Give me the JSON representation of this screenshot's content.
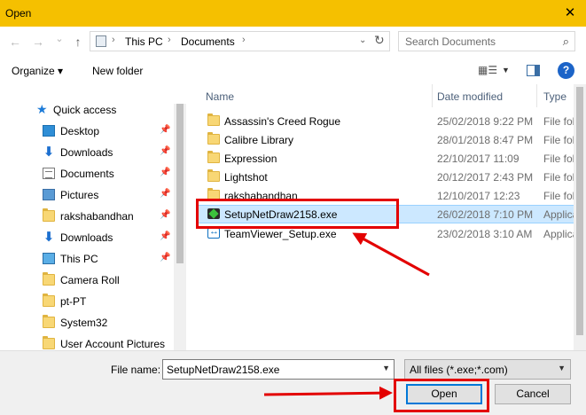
{
  "window": {
    "title": "Open",
    "close_glyph": "✕"
  },
  "address": {
    "crumbs": [
      "This PC",
      "Documents"
    ],
    "separator": "›",
    "dropdown_glyph": "⌄",
    "refresh_glyph": "↻"
  },
  "nav": {
    "back_glyph": "←",
    "forward_glyph": "→",
    "recent_glyph": "⌄",
    "up_glyph": "↑"
  },
  "search": {
    "placeholder": "Search Documents",
    "icon": "search-icon"
  },
  "toolbar": {
    "organize_label": "Organize ▾",
    "new_folder_label": "New folder",
    "help_glyph": "?"
  },
  "sidebar": {
    "items": [
      {
        "label": "Quick access",
        "icon": "star-icon",
        "pinned": false
      },
      {
        "label": "Desktop",
        "icon": "desktop-icon",
        "pinned": true
      },
      {
        "label": "Downloads",
        "icon": "download-icon",
        "pinned": true
      },
      {
        "label": "Documents",
        "icon": "documents-icon",
        "pinned": true
      },
      {
        "label": "Pictures",
        "icon": "pictures-icon",
        "pinned": true
      },
      {
        "label": "rakshabandhan",
        "icon": "folder-icon",
        "pinned": true
      },
      {
        "label": "Downloads",
        "icon": "download-icon",
        "pinned": true
      },
      {
        "label": "This PC",
        "icon": "pc-icon",
        "pinned": true
      },
      {
        "label": "Camera Roll",
        "icon": "folder-icon",
        "pinned": false
      },
      {
        "label": "pt-PT",
        "icon": "folder-icon",
        "pinned": false
      },
      {
        "label": "System32",
        "icon": "folder-icon",
        "pinned": false
      },
      {
        "label": "User Account Pictures",
        "icon": "folder-icon",
        "pinned": false
      }
    ],
    "pin_glyph": "📌"
  },
  "columns": {
    "name": "Name",
    "date": "Date modified",
    "type": "Type"
  },
  "files": [
    {
      "name": "Assassin's Creed Rogue",
      "date": "25/02/2018 9:22 PM",
      "type": "File folder",
      "icon": "folder-icon"
    },
    {
      "name": "Calibre Library",
      "date": "28/01/2018 8:47 PM",
      "type": "File folder",
      "icon": "folder-icon"
    },
    {
      "name": "Expression",
      "date": "22/10/2017 11:09",
      "type": "File folder",
      "icon": "folder-icon"
    },
    {
      "name": "Lightshot",
      "date": "20/12/2017 2:43 PM",
      "type": "File folder",
      "icon": "folder-icon"
    },
    {
      "name": "rakshabandhan",
      "date": "12/10/2017 12:23",
      "type": "File folder",
      "icon": "folder-icon"
    },
    {
      "name": "SetupNetDraw2158.exe",
      "date": "26/02/2018 7:10 PM",
      "type": "Application",
      "icon": "netdraw-icon",
      "selected": true
    },
    {
      "name": "TeamViewer_Setup.exe",
      "date": "23/02/2018 3:10 AM",
      "type": "Application",
      "icon": "teamviewer-icon"
    }
  ],
  "bottom": {
    "file_name_label": "File name:",
    "file_name_value": "SetupNetDraw2158.exe",
    "filter_value": "All files (*.exe;*.com)",
    "open_label": "Open",
    "cancel_label": "Cancel"
  },
  "annotation_color": "#e30000",
  "accent_color": "#f5c000"
}
